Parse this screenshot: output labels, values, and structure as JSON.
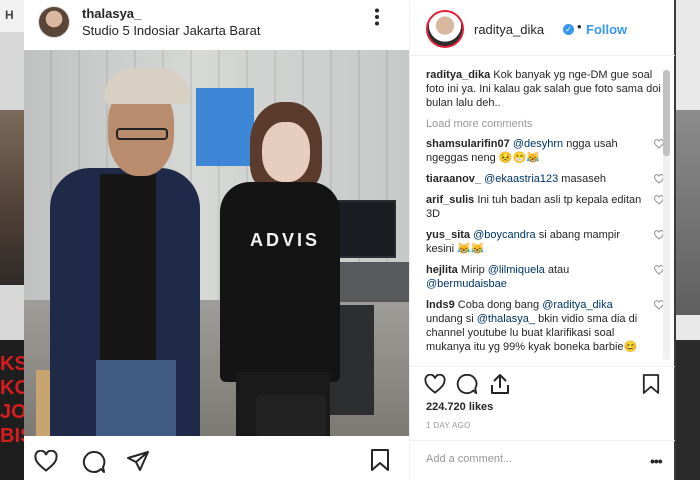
{
  "background": {
    "left_header_letter": "H",
    "left_red_text": "KSP KO JOT BIS"
  },
  "post": {
    "username": "thalasya_",
    "location": "Studio 5 Indosiar Jakarta Barat",
    "photo_shirt_text": "ADVIS"
  },
  "sidebar": {
    "username": "raditya_dika",
    "separator": "•",
    "follow_label": "Follow",
    "caption_user": "raditya_dika",
    "caption_text": " Kok banyak yg nge-DM gue soal foto ini ya. Ini kalau gak salah gue foto sama doi bulan lalu deh..",
    "load_more": "Load more comments",
    "comments": [
      {
        "user": "shamsularifin07",
        "parts": [
          {
            "m": "@desyhrn"
          },
          {
            "t": " ngga usah ngeggas neng 😣😁😹"
          }
        ]
      },
      {
        "user": "tiaraanov_",
        "parts": [
          {
            "m": "@ekaastria123"
          },
          {
            "t": " masaseh"
          }
        ]
      },
      {
        "user": "arif_sulis",
        "parts": [
          {
            "t": "Ini tuh badan asli tp kepala editan 3D"
          }
        ]
      },
      {
        "user": "yus_sita",
        "parts": [
          {
            "m": "@boycandra"
          },
          {
            "t": " si abang mampir kesini 😹😹"
          }
        ]
      },
      {
        "user": "hejlita",
        "parts": [
          {
            "t": "Mirip "
          },
          {
            "m": "@lilmiquela"
          },
          {
            "t": " atau "
          },
          {
            "m": "@bermudaisbae"
          }
        ]
      },
      {
        "user": "lnds9",
        "parts": [
          {
            "t": "Coba dong bang "
          },
          {
            "m": "@raditya_dika"
          },
          {
            "t": " undang si "
          },
          {
            "m": "@thalasya_"
          },
          {
            "t": " bkin vidio sma dia di channel youtube lu buat klarifikasi soal mukanya itu yg 99% kyak boneka barbie😊"
          }
        ]
      }
    ],
    "likes_count": "224.720",
    "likes_label": "likes",
    "time_ago": "1 DAY AGO",
    "add_comment_placeholder": "Add a comment...",
    "more_dots": "•••"
  },
  "icons": {
    "post_more": "more-vertical-icon",
    "heart": "heart-icon",
    "comment": "comment-icon",
    "share": "share-icon",
    "bookmark": "bookmark-icon",
    "verified": "verified-badge-icon"
  },
  "colors": {
    "link_blue": "#3897f0",
    "mention": "#003569",
    "story_ring": "#e0213b"
  }
}
